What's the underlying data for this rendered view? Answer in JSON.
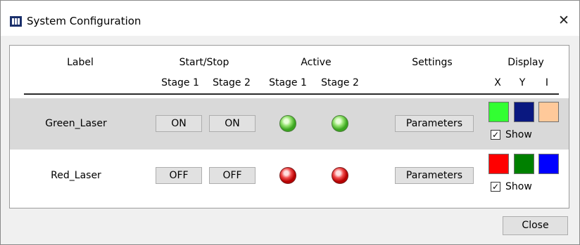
{
  "window": {
    "title": "System Configuration",
    "close_glyph": "✕",
    "app_icon": "app-logo-icon"
  },
  "headers": {
    "label": "Label",
    "start_stop": "Start/Stop",
    "active": "Active",
    "settings": "Settings",
    "display": "Display",
    "stage1_a": "Stage 1",
    "stage2_a": "Stage 2",
    "stage1_b": "Stage 1",
    "stage2_b": "Stage 2",
    "x": "X",
    "y": "Y",
    "i": "I"
  },
  "rows": [
    {
      "label": "Green_Laser",
      "stage1_state": "ON",
      "stage2_state": "ON",
      "active_color": "green",
      "settings_label": "Parameters",
      "display_colors": [
        "#32ff32",
        "#0a1880",
        "#ffc99a"
      ],
      "show_label": "Show",
      "show_checked": true
    },
    {
      "label": "Red_Laser",
      "stage1_state": "OFF",
      "stage2_state": "OFF",
      "active_color": "red",
      "settings_label": "Parameters",
      "display_colors": [
        "#ff0000",
        "#008000",
        "#0000ff"
      ],
      "show_label": "Show",
      "show_checked": true
    }
  ],
  "footer": {
    "close_label": "Close"
  }
}
